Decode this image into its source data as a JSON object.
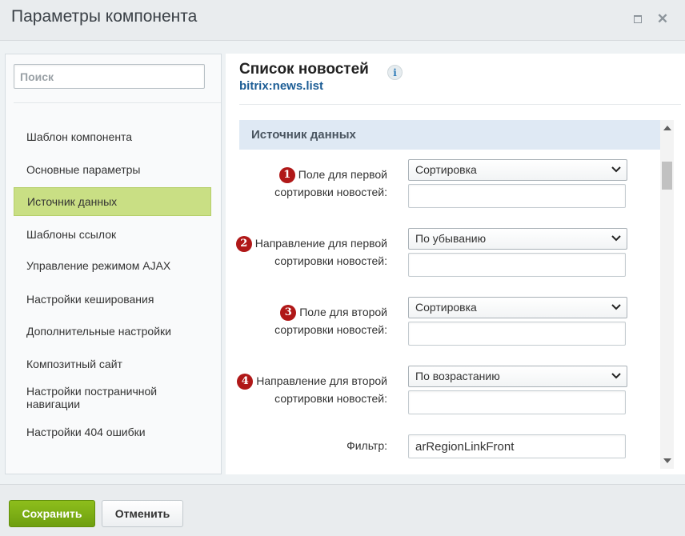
{
  "window": {
    "title": "Параметры компонента",
    "maximize_icon": "maximize-icon",
    "close_icon": "close-icon",
    "close_glyph": "✕"
  },
  "sidebar": {
    "search_placeholder": "Поиск",
    "items": [
      {
        "label": "Шаблон компонента",
        "active": false
      },
      {
        "label": "Основные параметры",
        "active": false
      },
      {
        "label": "Источник данных",
        "active": true
      },
      {
        "label": "Шаблоны ссылок",
        "active": false
      },
      {
        "label": "Управление режимом AJAX",
        "active": false
      },
      {
        "label": "Настройки кеширования",
        "active": false
      },
      {
        "label": "Дополнительные настройки",
        "active": false
      },
      {
        "label": "Композитный сайт",
        "active": false
      },
      {
        "label": "Настройки постраничной навигации",
        "active": false
      },
      {
        "label": "Настройки 404 ошибки",
        "active": false
      }
    ]
  },
  "component": {
    "title": "Список новостей",
    "info_glyph": "i",
    "code": "bitrix:news.list"
  },
  "section": {
    "title": "Источник данных",
    "fields": [
      {
        "marker": "1",
        "label_line1": "Поле для первой",
        "label_line2": "сортировки новостей:",
        "selected": "Сортировка",
        "extra_value": ""
      },
      {
        "marker": "2",
        "label_line1": "Направление для первой",
        "label_line2": "сортировки новостей:",
        "selected": "По убыванию",
        "extra_value": ""
      },
      {
        "marker": "3",
        "label_line1": "Поле для второй",
        "label_line2": "сортировки новостей:",
        "selected": "Сортировка",
        "extra_value": ""
      },
      {
        "marker": "4",
        "label_line1": "Направление для второй",
        "label_line2": "сортировки новостей:",
        "selected": "По возрастанию",
        "extra_value": ""
      }
    ],
    "filter": {
      "label": "Фильтр:",
      "value": "arRegionLinkFront"
    }
  },
  "footer": {
    "save_label": "Сохранить",
    "cancel_label": "Отменить"
  },
  "colors": {
    "active_item_bg": "#c9df84",
    "section_header_bg": "#dfe9f4",
    "marker_red": "#b01818",
    "save_green": "#7aab12",
    "link_blue": "#1c5d95"
  }
}
